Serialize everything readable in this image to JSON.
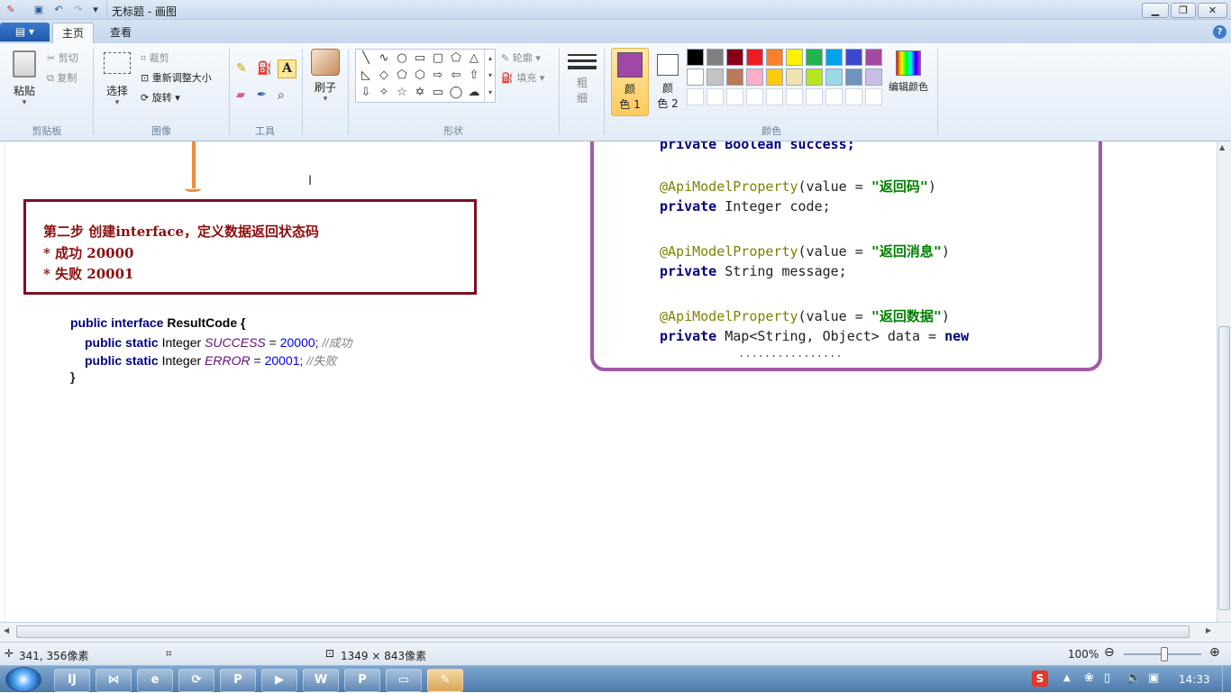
{
  "window": {
    "title": "无标题 - 画图",
    "qa_icons": [
      "paint-app-icon",
      "save-icon",
      "undo-icon",
      "redo-icon",
      "dropdown-icon"
    ],
    "controls": [
      "minimize-icon",
      "restore-icon",
      "close-icon"
    ]
  },
  "tabs": {
    "menu": "",
    "home": "主页",
    "view": "查看",
    "help": "?"
  },
  "ribbon": {
    "clipboard": {
      "paste": "粘贴",
      "cut": "剪切",
      "copy": "复制",
      "group": "剪贴板"
    },
    "image": {
      "select": "选择",
      "crop": "裁剪",
      "resize": "重新调整大小",
      "rotate": "旋转",
      "group": "图像"
    },
    "tools": {
      "group": "工具",
      "text_tool": "A"
    },
    "brush": {
      "label": "刷子"
    },
    "shapes": {
      "group": "形状",
      "outline": "轮廓",
      "fill": "填充"
    },
    "size": {
      "label1": "粗",
      "label2": "细"
    },
    "colors": {
      "color1a": "颜",
      "color1b": "色 1",
      "color2a": "颜",
      "color2b": "色 2",
      "edit": "编辑颜色",
      "group": "颜色",
      "primary": "#a147a5",
      "secondary": "#ffffff",
      "row1": [
        "#000000",
        "#7f7f7f",
        "#880015",
        "#ed1c24",
        "#ff7f27",
        "#fff200",
        "#22b14c",
        "#00a2e8",
        "#3f48cc",
        "#a349a4"
      ],
      "row2": [
        "#ffffff",
        "#c3c3c3",
        "#b97a57",
        "#ffaec9",
        "#ffc90e",
        "#efe4b0",
        "#b5e61d",
        "#99d9ea",
        "#7092be",
        "#c8bfe7"
      ]
    }
  },
  "canvas": {
    "step_lines": [
      "第二步 创建interface，定义数据返回状态码",
      "* 成功 20000",
      "* 失败 20001"
    ],
    "java": {
      "l1a": "public interface ",
      "l1b": "ResultCode {",
      "l2a": "public static ",
      "l2b": "Integer ",
      "l2c": "SUCCESS",
      "l2d": " = ",
      "l2e": "20000",
      "l2f": "; ",
      "l2g": "//成功",
      "l3a": "public static ",
      "l3b": "Integer ",
      "l3c": "ERROR",
      "l3d": " = ",
      "l3e": "20001",
      "l3f": "; ",
      "l3g": "//失败",
      "l4": "}"
    },
    "code": {
      "top": "private Boolean success;",
      "a1": "@ApiModelProperty",
      "a1b": "(value = ",
      "a1c": "\"返回码\"",
      "a1d": ")",
      "p1a": "private ",
      "p1b": "Integer code;",
      "a2": "@ApiModelProperty",
      "a2b": "(value = ",
      "a2c": "\"返回消息\"",
      "a2d": ")",
      "p2a": "private ",
      "p2b": "String message;",
      "a3": "@ApiModelProperty",
      "a3b": "(value = ",
      "a3c": "\"返回数据\"",
      "a3d": ")",
      "p3a": "private ",
      "p3b": "Map<String, Object> data = ",
      "p3c": "new",
      "dots": "................"
    }
  },
  "status": {
    "position": "341, 356像素",
    "dimensions": "1349 × 843像素",
    "zoom": "100%"
  },
  "taskbar": {
    "time": "14:33",
    "apps": [
      "intellij-icon",
      "vscode-icon",
      "ie-icon",
      "sync-icon",
      "p-icon",
      "media-icon",
      "word-icon",
      "powerpoint-icon",
      "folder-icon",
      "paint-taskbar-icon"
    ],
    "tray_s": "S"
  }
}
